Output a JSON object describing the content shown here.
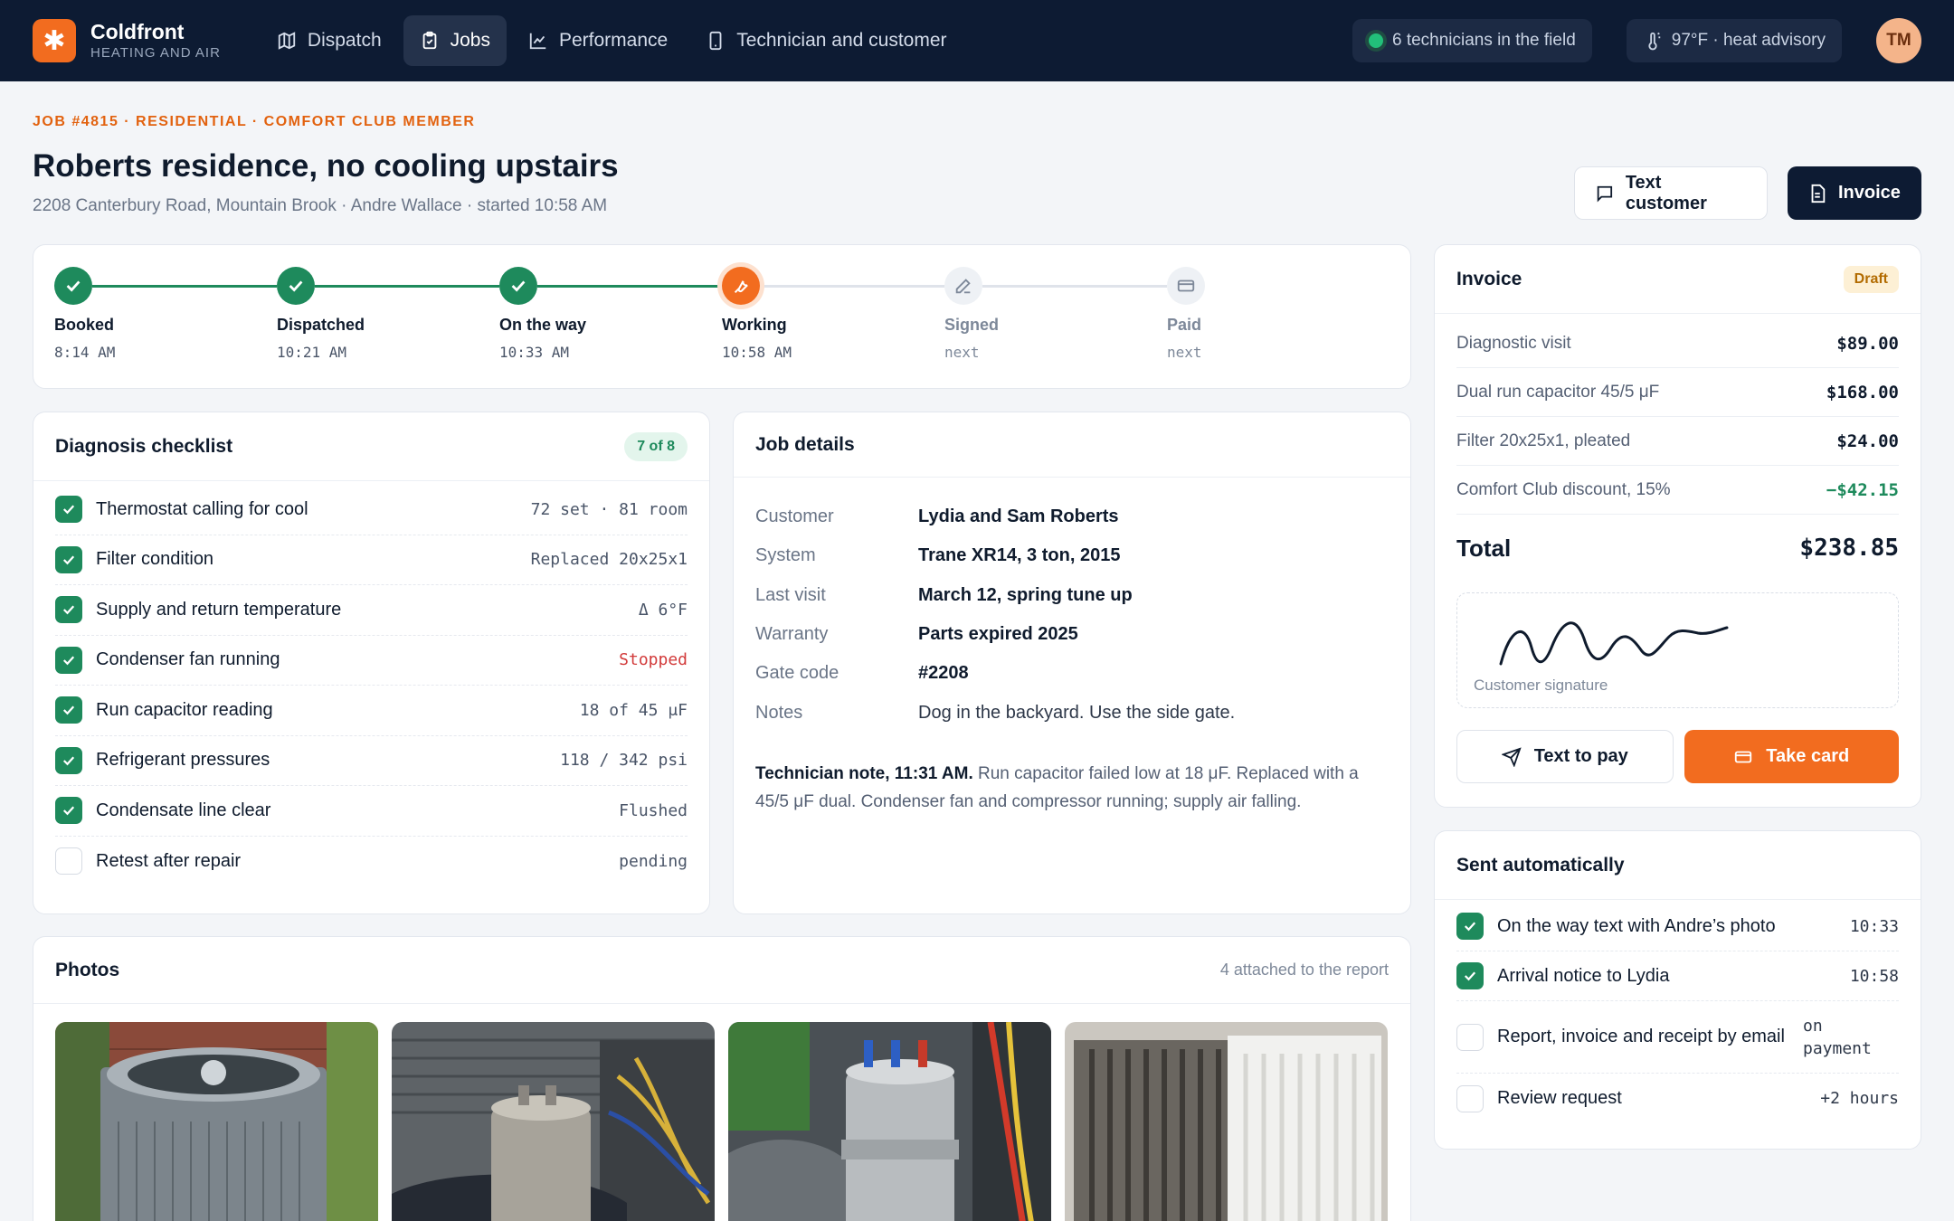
{
  "app": {
    "name": "Coldfront",
    "subtitle": "HEATING AND AIR",
    "logo_icon": "snowflake-icon"
  },
  "nav": [
    {
      "label": "Dispatch",
      "icon": "map-icon",
      "active": false
    },
    {
      "label": "Jobs",
      "icon": "clipboard-icon",
      "active": true
    },
    {
      "label": "Performance",
      "icon": "chart-icon",
      "active": false
    },
    {
      "label": "Technician and customer",
      "icon": "phone-icon",
      "active": false
    }
  ],
  "status": {
    "field": "6 technicians in the field",
    "weather": "97°F · heat advisory",
    "avatar": "TM"
  },
  "job": {
    "eyebrow": "JOB #4815 · RESIDENTIAL · COMFORT CLUB MEMBER",
    "title": "Roberts residence, no cooling upstairs",
    "subtitle": "2208 Canterbury Road, Mountain Brook · Andre Wallace · started 10:58 AM"
  },
  "actions": {
    "text_customer": "Text customer",
    "invoice": "Invoice"
  },
  "steps": [
    {
      "label": "Booked",
      "time": "8:14 AM",
      "state": "done"
    },
    {
      "label": "Dispatched",
      "time": "10:21 AM",
      "state": "done"
    },
    {
      "label": "On the way",
      "time": "10:33 AM",
      "state": "done"
    },
    {
      "label": "Working",
      "time": "10:58 AM",
      "state": "current"
    },
    {
      "label": "Signed",
      "time": "next",
      "state": "todo"
    },
    {
      "label": "Paid",
      "time": "next",
      "state": "todo"
    }
  ],
  "checklist": {
    "title": "Diagnosis checklist",
    "badge": "7 of 8",
    "items": [
      {
        "label": "Thermostat calling for cool",
        "value": "72 set · 81 room",
        "checked": true
      },
      {
        "label": "Filter condition",
        "value": "Replaced 20x25x1",
        "checked": true
      },
      {
        "label": "Supply and return temperature",
        "value": "Δ 6°F",
        "checked": true
      },
      {
        "label": "Condenser fan running",
        "value": "Stopped",
        "checked": true,
        "alert": true
      },
      {
        "label": "Run capacitor reading",
        "value": "18 of 45 μF",
        "checked": true
      },
      {
        "label": "Refrigerant pressures",
        "value": "118 / 342 psi",
        "checked": true
      },
      {
        "label": "Condensate line clear",
        "value": "Flushed",
        "checked": true
      },
      {
        "label": "Retest after repair",
        "value": "pending",
        "checked": false
      }
    ]
  },
  "details": {
    "title": "Job details",
    "rows": [
      {
        "key": "Customer",
        "value": "Lydia and Sam Roberts"
      },
      {
        "key": "System",
        "value": "Trane XR14, 3 ton, 2015"
      },
      {
        "key": "Last visit",
        "value": "March 12, spring tune up"
      },
      {
        "key": "Warranty",
        "value": "Parts expired 2025"
      },
      {
        "key": "Gate code",
        "value": "#2208"
      },
      {
        "key": "Notes",
        "value": "Dog in the backyard. Use the side gate."
      }
    ],
    "note_lead": "Technician note, 11:31 AM.",
    "note_body": " Run capacitor failed low at 18 μF. Replaced with a 45/5 μF dual. Condenser fan and compressor running; supply air falling."
  },
  "invoice": {
    "title": "Invoice",
    "status": "Draft",
    "lines": [
      {
        "label": "Diagnostic visit",
        "amount": "$89.00"
      },
      {
        "label": "Dual run capacitor 45/5 μF",
        "amount": "$168.00"
      },
      {
        "label": "Filter 20x25x1, pleated",
        "amount": "$24.00"
      },
      {
        "label": "Comfort Club discount, 15%",
        "amount": "−$42.15",
        "discount": true
      }
    ],
    "total_label": "Total",
    "total": "$238.85",
    "signature_label": "Customer signature",
    "text_to_pay": "Text to pay",
    "take_card": "Take card"
  },
  "auto": {
    "title": "Sent automatically",
    "items": [
      {
        "label": "On the way text with Andre’s photo",
        "time": "10:33",
        "checked": true
      },
      {
        "label": "Arrival notice to Lydia",
        "time": "10:58",
        "checked": true
      },
      {
        "label": "Report, invoice and receipt by email",
        "time": "on payment",
        "checked": false
      },
      {
        "label": "Review request",
        "time": "+2 hours",
        "checked": false
      }
    ]
  },
  "photos": {
    "title": "Photos",
    "meta": "4 attached to the report"
  }
}
